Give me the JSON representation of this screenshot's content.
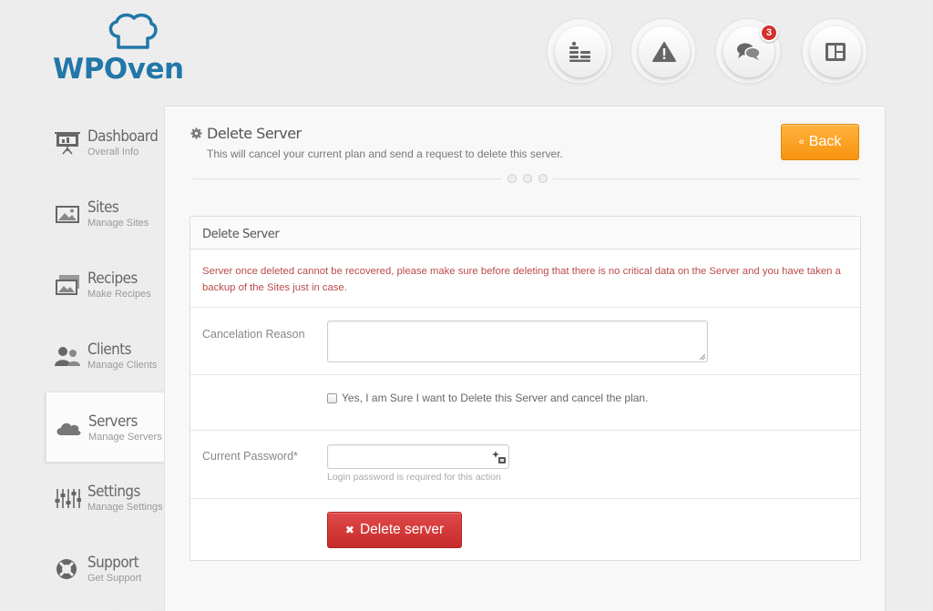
{
  "brand": {
    "logo_text": "WPOven"
  },
  "top_nav": {
    "notifications_badge": "3"
  },
  "sidebar": {
    "items": [
      {
        "title": "Dashboard",
        "subtitle": "Overall Info"
      },
      {
        "title": "Sites",
        "subtitle": "Manage Sites"
      },
      {
        "title": "Recipes",
        "subtitle": "Make Recipes"
      },
      {
        "title": "Clients",
        "subtitle": "Manage Clients"
      },
      {
        "title": "Servers",
        "subtitle": "Manage Servers",
        "active": true
      },
      {
        "title": "Settings",
        "subtitle": "Manage Settings"
      },
      {
        "title": "Support",
        "subtitle": "Get Support"
      }
    ]
  },
  "page": {
    "title": "Delete Server",
    "subtitle": "This will cancel your current plan and send a request to delete this server.",
    "back_label": "Back"
  },
  "form": {
    "heading": "Delete Server",
    "warning": "Server once deleted cannot be recovered, please make sure before deleting that there is no critical data on the Server and you have taken a backup of the Sites just in case.",
    "reason_label": "Cancelation Reason",
    "reason_value": "",
    "confirm_label": "Yes, I am Sure I want to Delete this Server and cancel the plan.",
    "confirm_checked": false,
    "password_label": "Current Password*",
    "password_value": "",
    "password_help": "Login password is required for this action",
    "delete_label": "Delete server"
  },
  "colors": {
    "brand_blue": "#2277a8",
    "back_orange": "#f7930d",
    "delete_red": "#c62b2b",
    "warning_text": "#b94a48",
    "badge_red": "#d32f2f"
  }
}
